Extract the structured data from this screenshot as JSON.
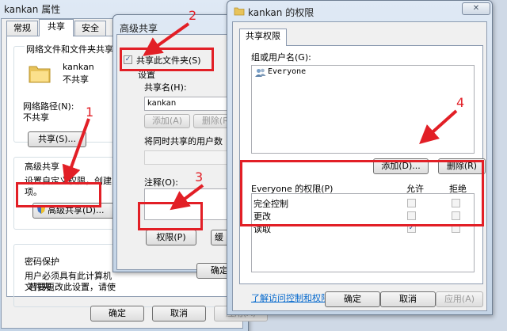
{
  "win1": {
    "title": "kankan 属性",
    "tabs": [
      "常规",
      "共享",
      "安全"
    ],
    "section_network_title": "网络文件和文件夹共享",
    "folder_name": "kankan",
    "folder_status": "不共享",
    "network_path_label": "网络路径(N):",
    "network_path_value": "不共享",
    "share_button": "共享(S)...",
    "advanced_title": "高级共享",
    "advanced_desc1": "设置自定义权限，创建",
    "advanced_desc2": "项。",
    "advanced_button": "高级共享(D)...",
    "password_title": "密码保护",
    "password_desc1": "用户必须具有此计算机",
    "password_desc2": "文件夹。",
    "password_desc3": "若要更改此设置，请使",
    "ok": "确定",
    "cancel": "取消",
    "apply": "应用(A)"
  },
  "win2": {
    "title": "高级共享",
    "share_checkbox": "共享此文件夹(S)",
    "settings_label": "设置",
    "share_name_label": "共享名(H):",
    "share_name_value": "kankan",
    "add_button": "添加(A)",
    "remove_button": "删除(R)",
    "limit_label": "将同时共享的用户数",
    "comment_label": "注释(O):",
    "permissions_button": "权限(P)",
    "cache_button": "缓",
    "ok": "确定"
  },
  "win3": {
    "title": "kankan 的权限",
    "tab": "共享权限",
    "group_label": "组或用户名(G):",
    "users": [
      "Everyone"
    ],
    "add_button": "添加(D)...",
    "remove_button": "删除(R)",
    "perm_label": "Everyone 的权限(P)",
    "allow_header": "允许",
    "deny_header": "拒绝",
    "permissions": [
      {
        "name": "完全控制",
        "allow": false,
        "deny": false
      },
      {
        "name": "更改",
        "allow": false,
        "deny": false
      },
      {
        "name": "读取",
        "allow": true,
        "deny": false
      }
    ],
    "link": "了解访问控制和权限",
    "ok": "确定",
    "cancel": "取消",
    "apply": "应用(A)"
  },
  "annotations": {
    "step1": "1",
    "step2": "2",
    "step3": "3",
    "step4": "4",
    "color": "#e21f26"
  }
}
